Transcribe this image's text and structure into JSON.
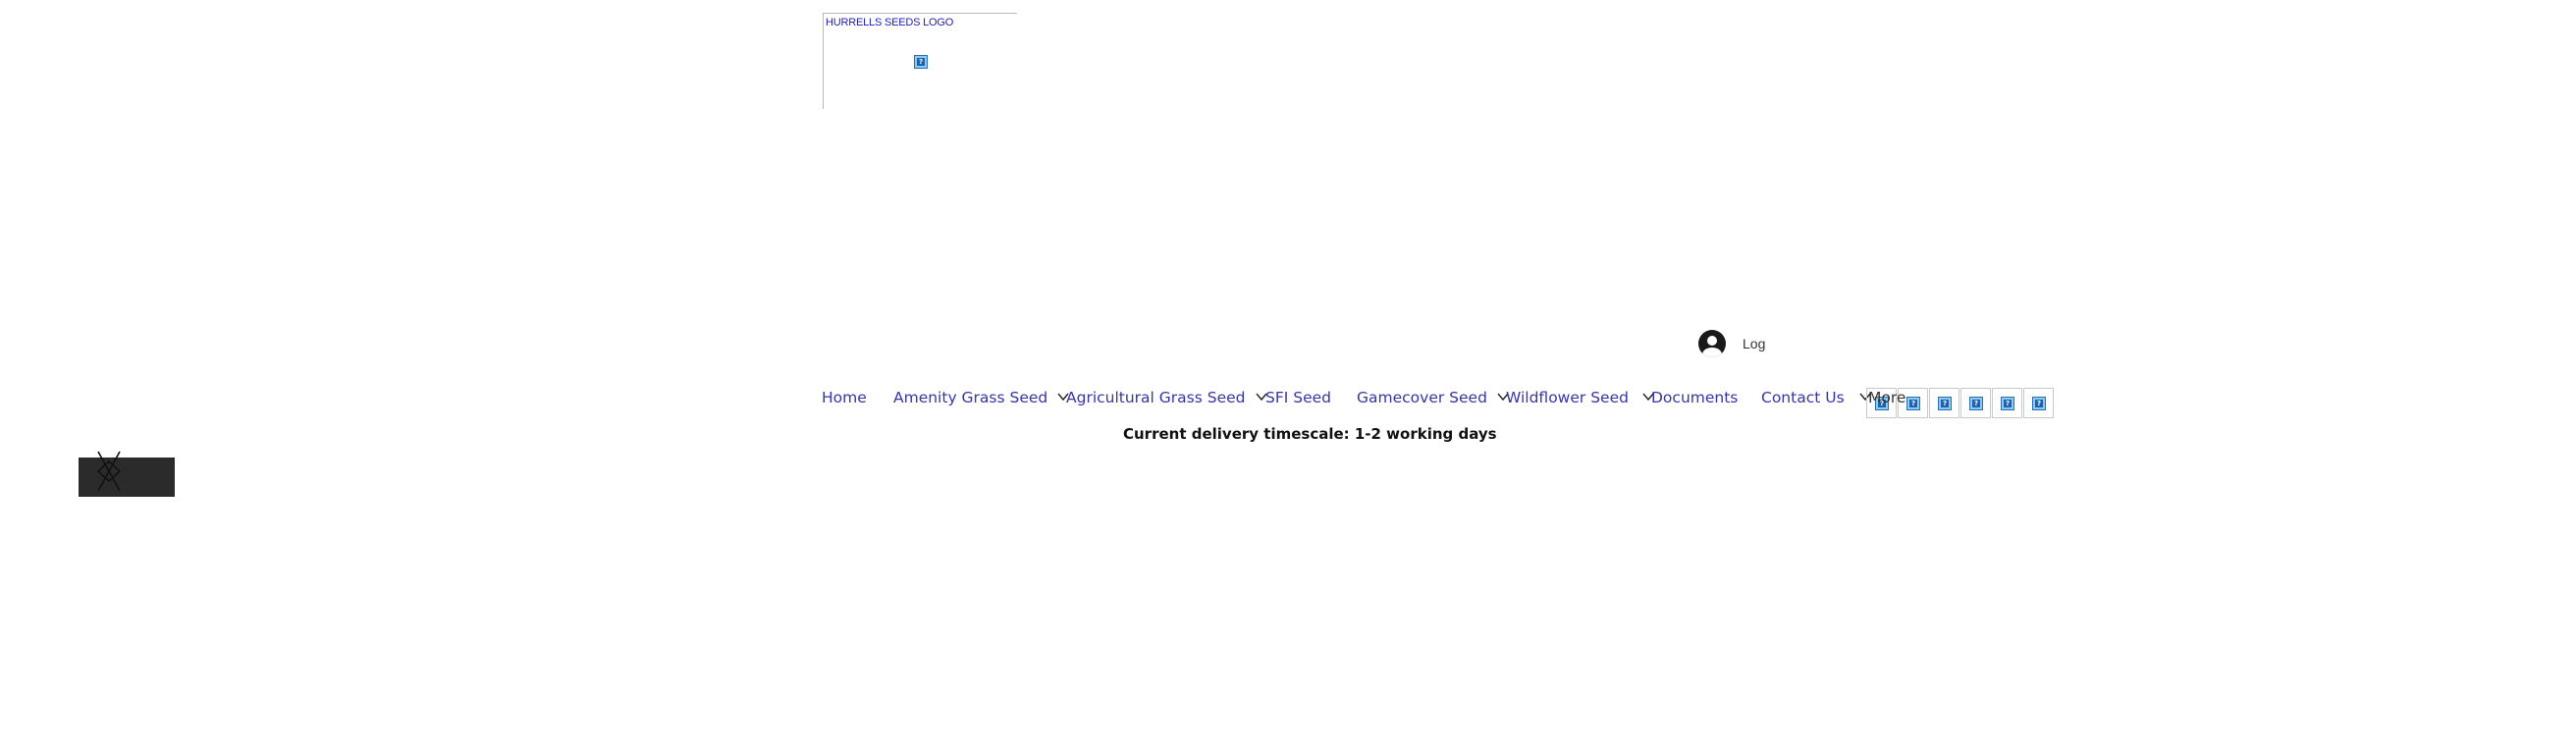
{
  "header": {
    "logo_alt": "HURRELLS SEEDS LOGO"
  },
  "login": {
    "label": "Log",
    "icon": "user-avatar-icon"
  },
  "nav": {
    "items": [
      {
        "label": "Home",
        "has_dropdown": false
      },
      {
        "label": "Amenity Grass Seed",
        "has_dropdown": true
      },
      {
        "label": "Agricultural Grass Seed",
        "has_dropdown": true
      },
      {
        "label": "SFI Seed",
        "has_dropdown": false
      },
      {
        "label": "Gamecover Seed",
        "has_dropdown": true
      },
      {
        "label": "Wildflower Seed",
        "has_dropdown": true
      },
      {
        "label": "Documents",
        "has_dropdown": false
      },
      {
        "label": "Contact Us",
        "has_dropdown": true
      },
      {
        "label": "More",
        "has_dropdown": false
      }
    ]
  },
  "banner": {
    "delivery_text": "Current delivery timescale: 1-2 working days"
  },
  "colors": {
    "nav_link": "#3636a6",
    "logo_alt": "#1d1db8",
    "dark_button": "#2b2b2b"
  }
}
